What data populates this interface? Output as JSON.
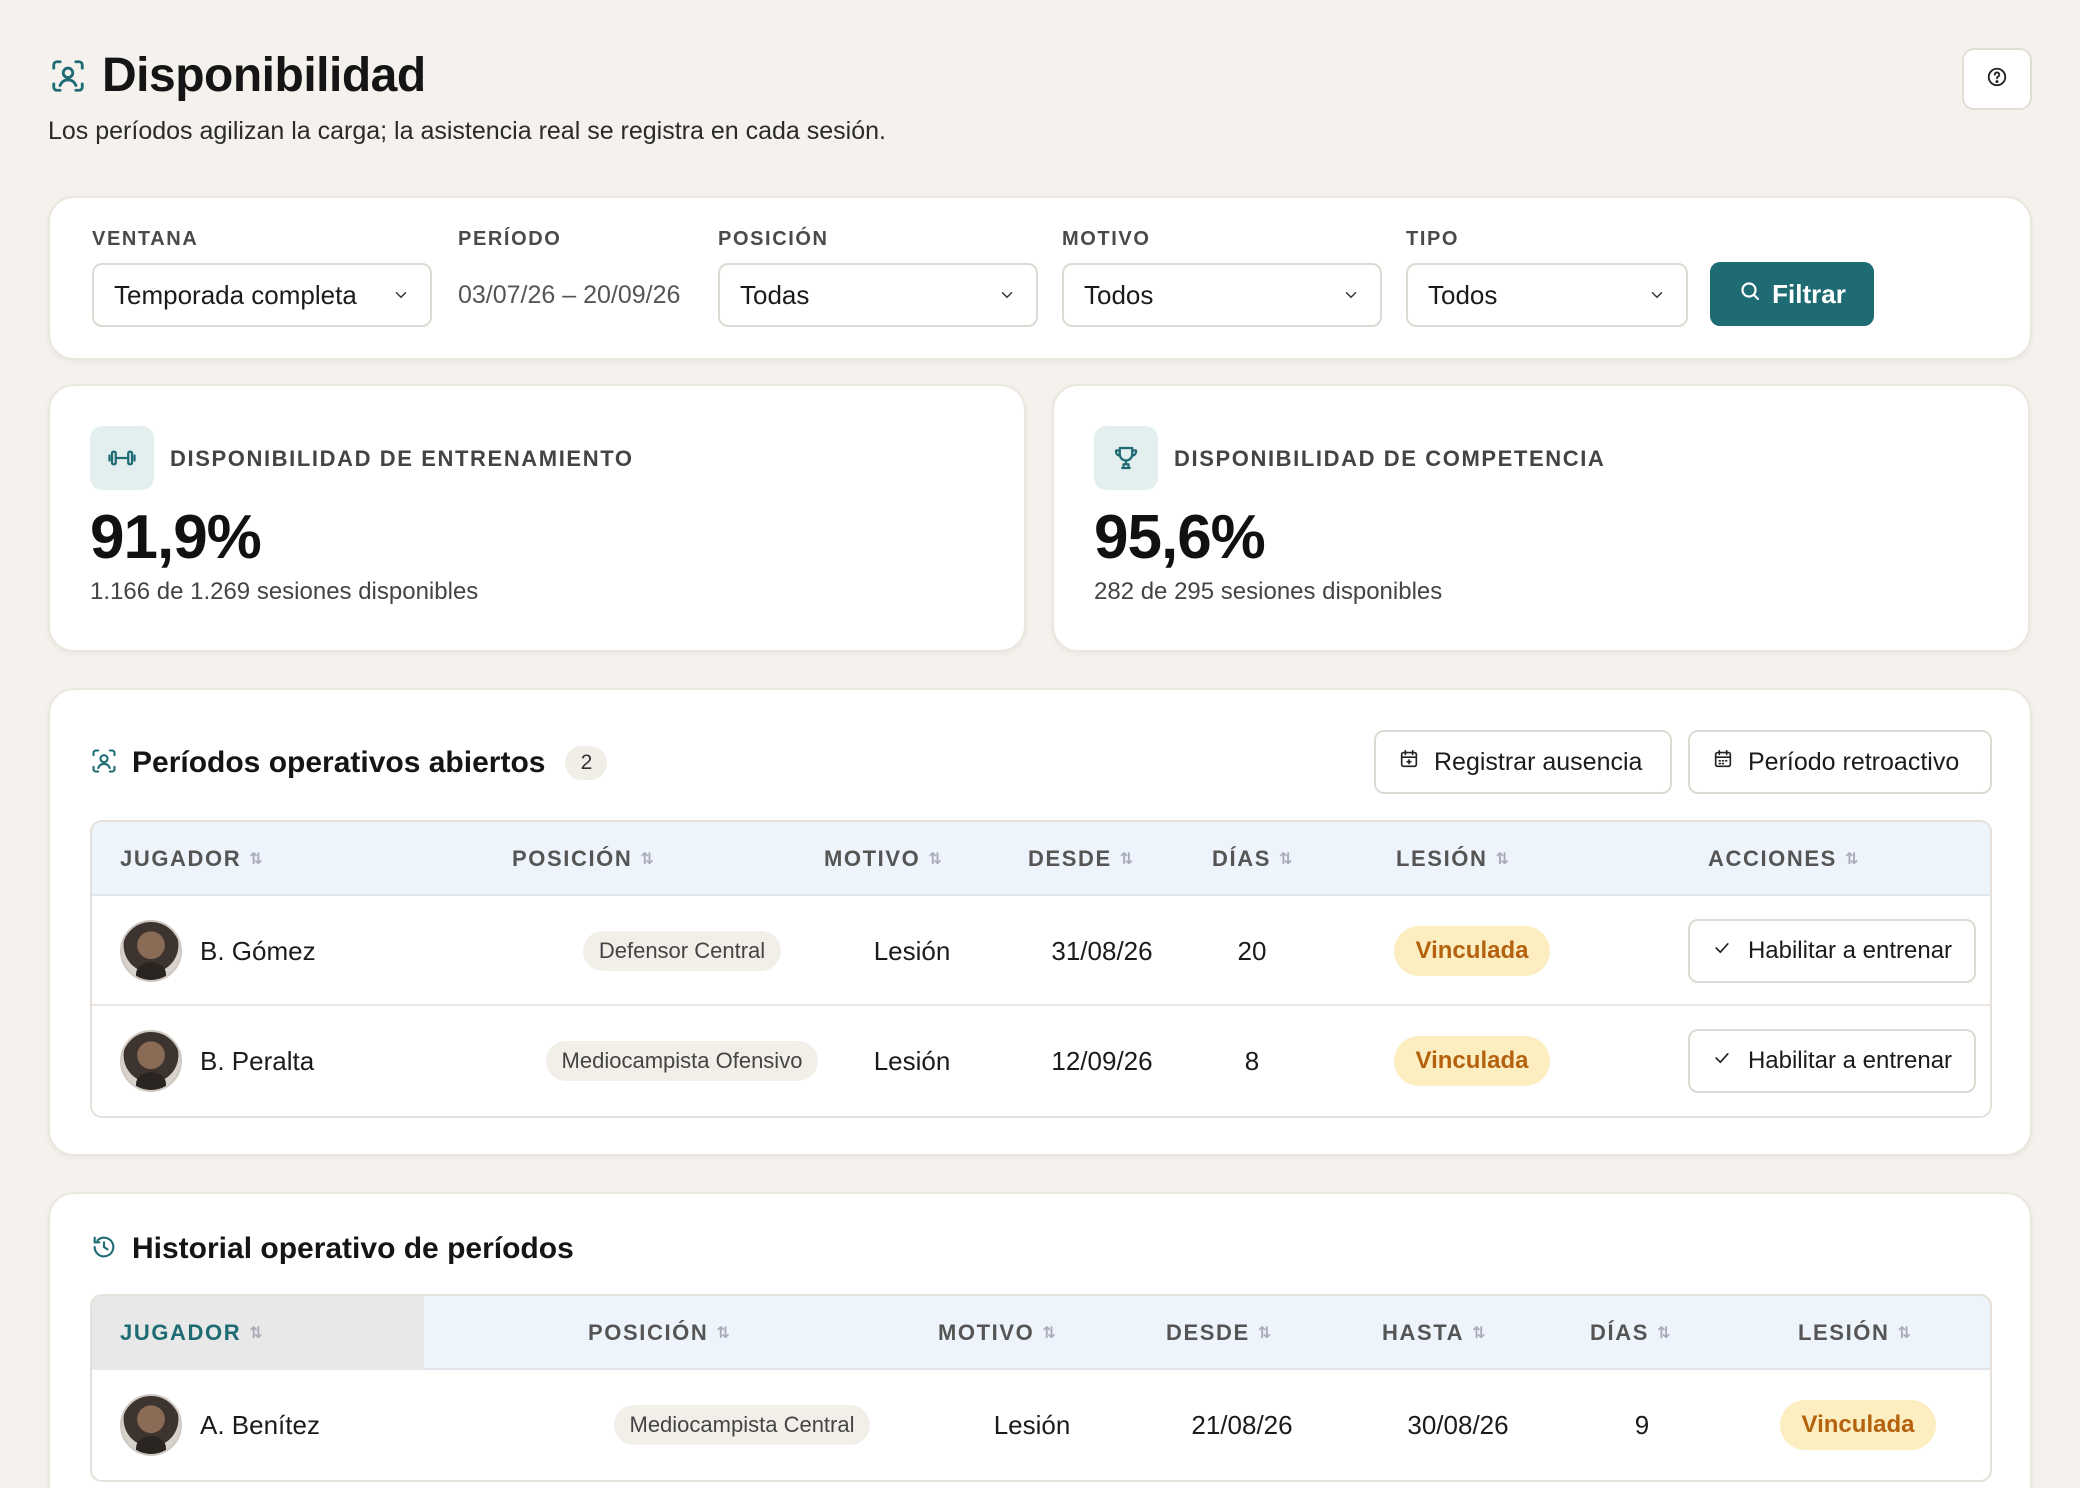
{
  "header": {
    "title": "Disponibilidad",
    "subtitle": "Los períodos agilizan la carga; la asistencia real se registra en cada sesión."
  },
  "filters": {
    "ventana": {
      "label": "VENTANA",
      "value": "Temporada completa"
    },
    "periodo": {
      "label": "PERÍODO",
      "value": "03/07/26 – 20/09/26"
    },
    "posicion": {
      "label": "POSICIÓN",
      "value": "Todas"
    },
    "motivo": {
      "label": "MOTIVO",
      "value": "Todos"
    },
    "tipo": {
      "label": "TIPO",
      "value": "Todos"
    },
    "button_label": "Filtrar"
  },
  "kpis": {
    "training": {
      "label": "DISPONIBILIDAD DE ENTRENAMIENTO",
      "value": "91,9%",
      "sub": "1.166 de 1.269 sesiones disponibles"
    },
    "competition": {
      "label": "DISPONIBILIDAD DE COMPETENCIA",
      "value": "95,6%",
      "sub": "282 de 295 sesiones disponibles"
    }
  },
  "open_periods": {
    "title": "Períodos operativos abiertos",
    "count": "2",
    "register_absence": "Registrar ausencia",
    "retroactive_period": "Período retroactivo",
    "columns": [
      "JUGADOR",
      "POSICIÓN",
      "MOTIVO",
      "DESDE",
      "DÍAS",
      "LESIÓN",
      "ACCIONES"
    ],
    "rows": [
      {
        "player": "B. Gómez",
        "position": "Defensor Central",
        "reason": "Lesión",
        "from": "31/08/26",
        "days": "20",
        "injury": "Vinculada",
        "action": "Habilitar a entrenar"
      },
      {
        "player": "B. Peralta",
        "position": "Mediocampista Ofensivo",
        "reason": "Lesión",
        "from": "12/09/26",
        "days": "8",
        "injury": "Vinculada",
        "action": "Habilitar a entrenar"
      }
    ]
  },
  "history": {
    "title": "Historial operativo de períodos",
    "columns": [
      "JUGADOR",
      "POSICIÓN",
      "MOTIVO",
      "DESDE",
      "HASTA",
      "DÍAS",
      "LESIÓN"
    ],
    "rows": [
      {
        "player": "A. Benítez",
        "position": "Mediocampista Central",
        "reason": "Lesión",
        "from": "21/08/26",
        "to": "30/08/26",
        "days": "9",
        "injury": "Vinculada"
      }
    ]
  },
  "colors": {
    "accent": "#1f6b74",
    "page_bg": "#f5f2ed",
    "badge_warn_bg": "#fdeec2",
    "badge_warn_text": "#b5620e"
  },
  "icons": {
    "title": "user-scan-icon",
    "help": "help-circle-icon",
    "training": "dumbbell-icon",
    "competition": "trophy-icon",
    "history": "history-icon",
    "calendar": "calendar-icon",
    "check": "check-icon",
    "search": "search-icon"
  }
}
